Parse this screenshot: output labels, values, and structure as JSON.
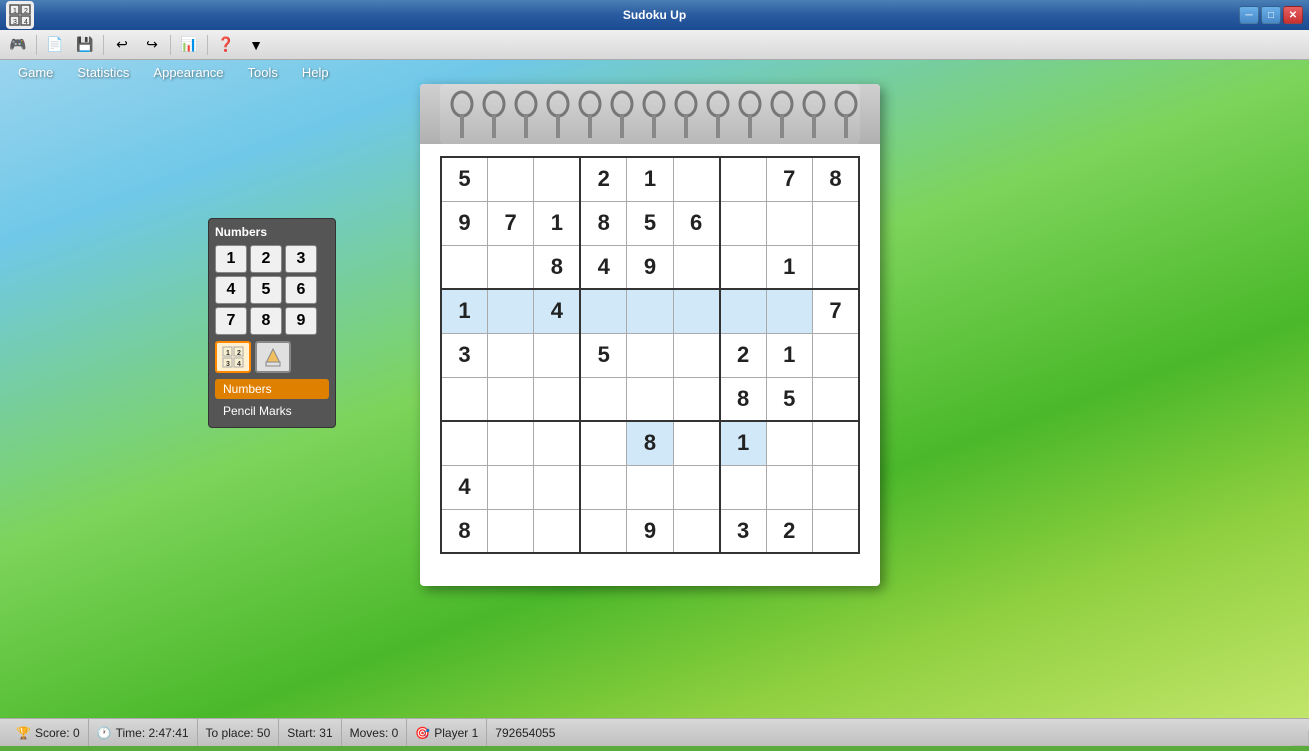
{
  "window": {
    "title": "Sudoku Up",
    "min_label": "─",
    "max_label": "□",
    "close_label": "✕"
  },
  "toolbar": {
    "icons": [
      "🎮",
      "📄",
      "💾",
      "↩",
      "↪",
      "📊",
      "❓",
      "▼"
    ]
  },
  "menu": {
    "items": [
      "Game",
      "Statistics",
      "Appearance",
      "Tools",
      "Help"
    ]
  },
  "numbers_panel": {
    "title": "Numbers",
    "digits": [
      "1",
      "2",
      "3",
      "4",
      "5",
      "6",
      "7",
      "8",
      "9"
    ],
    "mode_numbers": "Numbers",
    "mode_pencil": "Pencil Marks"
  },
  "board": {
    "spiral_count": 13
  },
  "sudoku": {
    "grid": [
      [
        {
          "v": "5",
          "h": false
        },
        {
          "v": "",
          "h": false
        },
        {
          "v": "",
          "h": false
        },
        {
          "v": "2",
          "h": false
        },
        {
          "v": "1",
          "h": false
        },
        {
          "v": "",
          "h": false
        },
        {
          "v": "",
          "h": false
        },
        {
          "v": "7",
          "h": false
        },
        {
          "v": "8",
          "h": false
        }
      ],
      [
        {
          "v": "9",
          "h": false
        },
        {
          "v": "7",
          "h": false
        },
        {
          "v": "1",
          "h": false
        },
        {
          "v": "8",
          "h": false
        },
        {
          "v": "5",
          "h": false
        },
        {
          "v": "6",
          "h": false
        },
        {
          "v": "",
          "h": false
        },
        {
          "v": "",
          "h": false
        },
        {
          "v": "",
          "h": false
        }
      ],
      [
        {
          "v": "",
          "h": false
        },
        {
          "v": "",
          "h": false
        },
        {
          "v": "8",
          "h": false
        },
        {
          "v": "4",
          "h": false
        },
        {
          "v": "9",
          "h": false
        },
        {
          "v": "",
          "h": false
        },
        {
          "v": "",
          "h": false
        },
        {
          "v": "1",
          "h": false
        },
        {
          "v": "",
          "h": false
        }
      ],
      [
        {
          "v": "1",
          "h": true
        },
        {
          "v": "",
          "h": true
        },
        {
          "v": "4",
          "h": true
        },
        {
          "v": "",
          "h": true
        },
        {
          "v": "",
          "h": true
        },
        {
          "v": "",
          "h": true
        },
        {
          "v": "",
          "h": true
        },
        {
          "v": "",
          "h": true
        },
        {
          "v": "7",
          "h": false
        }
      ],
      [
        {
          "v": "3",
          "h": false
        },
        {
          "v": "",
          "h": false
        },
        {
          "v": "",
          "h": false
        },
        {
          "v": "5",
          "h": false
        },
        {
          "v": "",
          "h": false
        },
        {
          "v": "",
          "h": false
        },
        {
          "v": "2",
          "h": false
        },
        {
          "v": "1",
          "h": false
        },
        {
          "v": "",
          "h": false
        }
      ],
      [
        {
          "v": "",
          "h": false
        },
        {
          "v": "",
          "h": false
        },
        {
          "v": "",
          "h": false
        },
        {
          "v": "",
          "h": false
        },
        {
          "v": "",
          "h": false
        },
        {
          "v": "",
          "h": false
        },
        {
          "v": "8",
          "h": false
        },
        {
          "v": "5",
          "h": false
        },
        {
          "v": "",
          "h": false
        }
      ],
      [
        {
          "v": "",
          "h": false
        },
        {
          "v": "",
          "h": false
        },
        {
          "v": "",
          "h": false
        },
        {
          "v": "",
          "h": false
        },
        {
          "v": "8",
          "h": true
        },
        {
          "v": "",
          "h": false
        },
        {
          "v": "1",
          "h": true
        },
        {
          "v": "",
          "h": false
        },
        {
          "v": "",
          "h": false
        }
      ],
      [
        {
          "v": "4",
          "h": false
        },
        {
          "v": "",
          "h": false
        },
        {
          "v": "",
          "h": false
        },
        {
          "v": "",
          "h": false
        },
        {
          "v": "",
          "h": false
        },
        {
          "v": "",
          "h": false
        },
        {
          "v": "",
          "h": false
        },
        {
          "v": "",
          "h": false
        },
        {
          "v": "",
          "h": false
        }
      ],
      [
        {
          "v": "8",
          "h": false
        },
        {
          "v": "",
          "h": false
        },
        {
          "v": "",
          "h": false
        },
        {
          "v": "",
          "h": false
        },
        {
          "v": "9",
          "h": false
        },
        {
          "v": "",
          "h": false
        },
        {
          "v": "3",
          "h": false
        },
        {
          "v": "2",
          "h": false
        },
        {
          "v": "",
          "h": false
        }
      ]
    ]
  },
  "status": {
    "score": "Score: 0",
    "time": "Time: 2:47:41",
    "to_place": "To place: 50",
    "start": "Start: 31",
    "moves": "Moves: 0",
    "player": "Player 1",
    "game_id": "792654055"
  }
}
